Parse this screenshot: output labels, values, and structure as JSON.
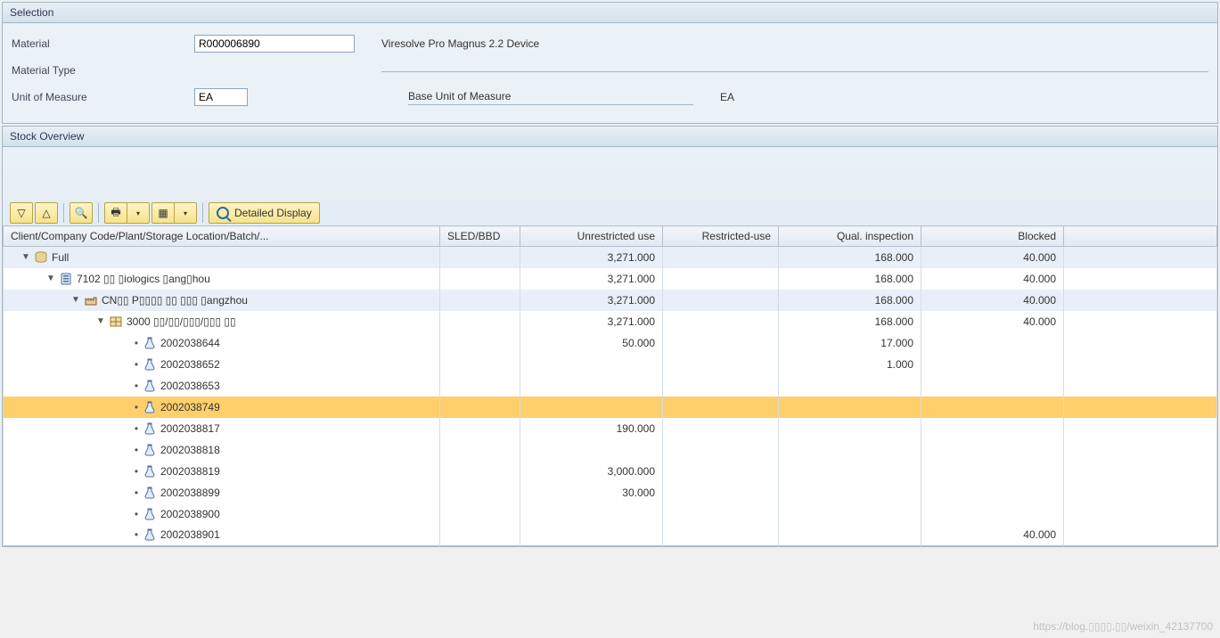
{
  "selection": {
    "title": "Selection",
    "material_label": "Material",
    "material_value": "R000006890",
    "material_desc": "Viresolve Pro Magnus 2.2 Device",
    "material_type_label": "Material Type",
    "material_type_value": "",
    "material_type_desc": "",
    "uom_label": "Unit of Measure",
    "uom_value": "EA",
    "base_uom_label": "Base Unit of Measure",
    "base_uom_value": "EA"
  },
  "stock": {
    "title": "Stock Overview",
    "toolbar": {
      "detailed_display": "Detailed Display"
    },
    "columns": {
      "hierarchy": "Client/Company Code/Plant/Storage Location/Batch/...",
      "sled": "SLED/BBD",
      "unrestricted": "Unrestricted use",
      "restricted": "Restricted-use",
      "qual": "Qual. inspection",
      "blocked": "Blocked"
    },
    "rows": [
      {
        "level": 0,
        "kind": "full",
        "label": "Full",
        "unr": "3,271.000",
        "qual": "168.000",
        "blk": "40.000",
        "alt": true,
        "sel": false,
        "exp": true
      },
      {
        "level": 1,
        "kind": "comp",
        "label": "7102 ▯▯   ▯iologics ▯ang▯hou",
        "unr": "3,271.000",
        "qual": "168.000",
        "blk": "40.000",
        "alt": false,
        "sel": false,
        "exp": true
      },
      {
        "level": 2,
        "kind": "plant",
        "label": "CN▯▯ P▯▯▯▯ ▯▯   ▯▯▯ ▯angzhou",
        "unr": "3,271.000",
        "qual": "168.000",
        "blk": "40.000",
        "alt": true,
        "sel": false,
        "exp": true
      },
      {
        "level": 3,
        "kind": "sloc",
        "label": "3000 ▯▯/▯▯/▯▯▯/▯▯▯ ▯▯",
        "unr": "3,271.000",
        "qual": "168.000",
        "blk": "40.000",
        "alt": false,
        "sel": false,
        "exp": true
      },
      {
        "level": 4,
        "kind": "batch",
        "label": "2002038644",
        "unr": "50.000",
        "qual": "17.000",
        "blk": "",
        "alt": false,
        "sel": false,
        "exp": false
      },
      {
        "level": 4,
        "kind": "batch",
        "label": "2002038652",
        "unr": "",
        "qual": "1.000",
        "blk": "",
        "alt": false,
        "sel": false,
        "exp": false
      },
      {
        "level": 4,
        "kind": "batch",
        "label": "2002038653",
        "unr": "",
        "qual": "",
        "blk": "",
        "alt": false,
        "sel": false,
        "exp": false
      },
      {
        "level": 4,
        "kind": "batch",
        "label": "2002038749",
        "unr": "",
        "qual": "",
        "blk": "",
        "alt": false,
        "sel": true,
        "exp": false
      },
      {
        "level": 4,
        "kind": "batch",
        "label": "2002038817",
        "unr": "190.000",
        "qual": "",
        "blk": "",
        "alt": false,
        "sel": false,
        "exp": false
      },
      {
        "level": 4,
        "kind": "batch",
        "label": "2002038818",
        "unr": "",
        "qual": "",
        "blk": "",
        "alt": false,
        "sel": false,
        "exp": false
      },
      {
        "level": 4,
        "kind": "batch",
        "label": "2002038819",
        "unr": "3,000.000",
        "qual": "",
        "blk": "",
        "alt": false,
        "sel": false,
        "exp": false
      },
      {
        "level": 4,
        "kind": "batch",
        "label": "2002038899",
        "unr": "30.000",
        "qual": "",
        "blk": "",
        "alt": false,
        "sel": false,
        "exp": false
      },
      {
        "level": 4,
        "kind": "batch",
        "label": "2002038900",
        "unr": "",
        "qual": "",
        "blk": "",
        "alt": false,
        "sel": false,
        "exp": false
      },
      {
        "level": 4,
        "kind": "batch",
        "label": "2002038901",
        "unr": "",
        "qual": "",
        "blk": "40.000",
        "alt": false,
        "sel": false,
        "exp": false
      }
    ]
  },
  "watermark": "https://blog.▯▯▯▯.▯▯/weixin_42137700"
}
